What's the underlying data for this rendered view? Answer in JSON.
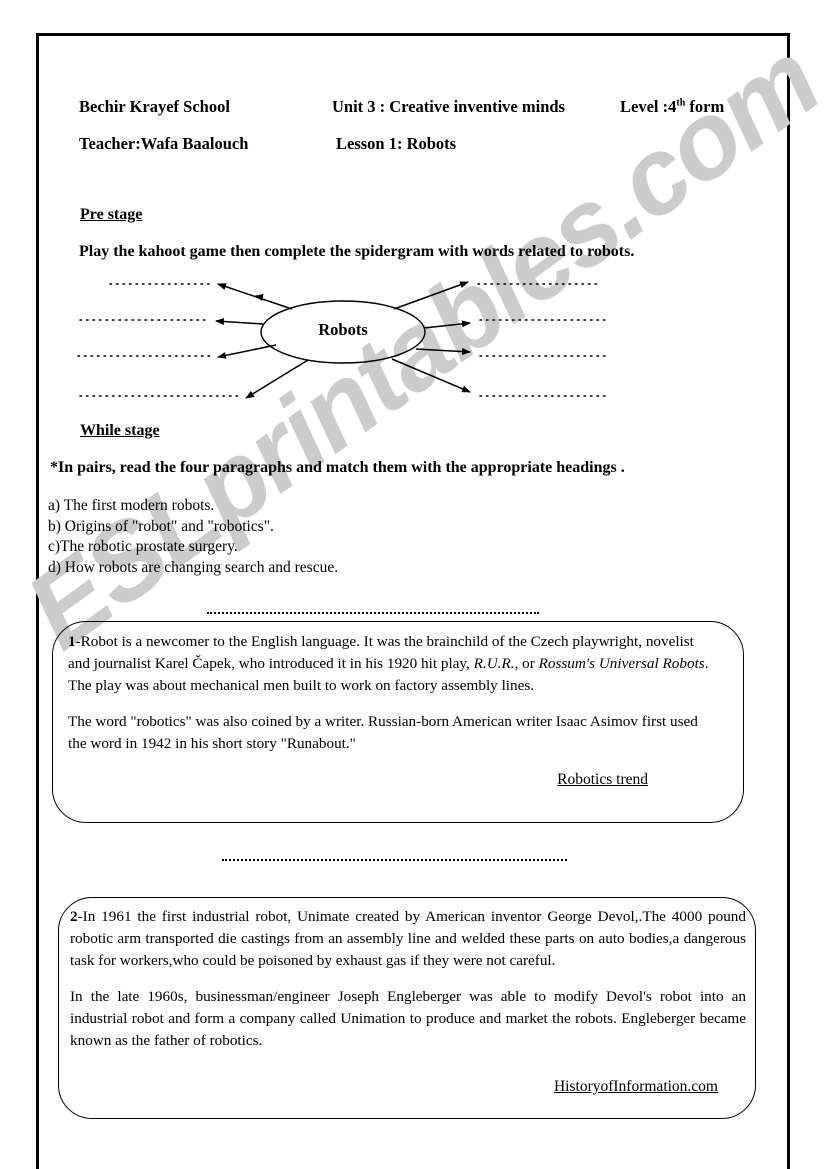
{
  "header": {
    "school": "Bechir Krayef  School",
    "unit": "Unit 3 :  Creative inventive minds",
    "level_prefix": "Level :4",
    "level_ordinal": "th",
    "level_suffix": " form",
    "teacher": "Teacher:Wafa Baalouch",
    "lesson": "Lesson 1:  Robots"
  },
  "pre_stage": {
    "heading": "Pre stage",
    "instruction": "Play the kahoot game then complete the spidergram with words related to robots.",
    "diagram": {
      "center_label": "Robots",
      "branch_count": 8,
      "blank_lines": 8
    }
  },
  "while_stage": {
    "heading": "While stage",
    "instruction": "*In pairs, read the four paragraphs and match them with the appropriate headings .",
    "options": [
      "a) The first modern robots.",
      "b) Origins of \"robot\" and \"robotics\".",
      "c)The robotic prostate surgery.",
      "d) How robots are changing search and rescue."
    ]
  },
  "paragraphs": [
    {
      "number": "1",
      "answer_placeholder": "",
      "body_1_a": "-Robot is a  newcomer to the English language. It was the brainchild of the Czech playwright, novelist and journalist Karel Čapek, who introduced it in his 1920 hit play, ",
      "body_1_italic_1": "R.U.R.",
      "body_1_b": ", or ",
      "body_1_italic_2": "Rossum's Universal Robots",
      "body_1_c": ". The play  was about mechanical men built to work on factory assembly lines.",
      "body_2": "The word \"robotics\" was also coined by a writer. Russian-born American writer Isaac Asimov first used the word in 1942 in his short story \"Runabout.\"",
      "source": "Robotics trend"
    },
    {
      "number": "2",
      "answer_placeholder": "",
      "body_1": "-In 1961 the first industrial robot, Unimate created by American inventor George Devol,.The 4000 pound robotic arm transported die castings from an assembly line and welded these parts on auto bodies,a dangerous task for workers,who could be poisoned by exhaust gas if they were not careful.",
      "body_2": "In the late 1960s, businessman/engineer Joseph Engleberger was able to modify Devol's robot into an industrial robot and form a company called Unimation to produce and market the robots. Engleberger became known as the father of robotics.",
      "source": "HistoryofInformation.com"
    }
  ],
  "watermark": {
    "text": "ESLprintables.com",
    "color": "#cccccc"
  }
}
